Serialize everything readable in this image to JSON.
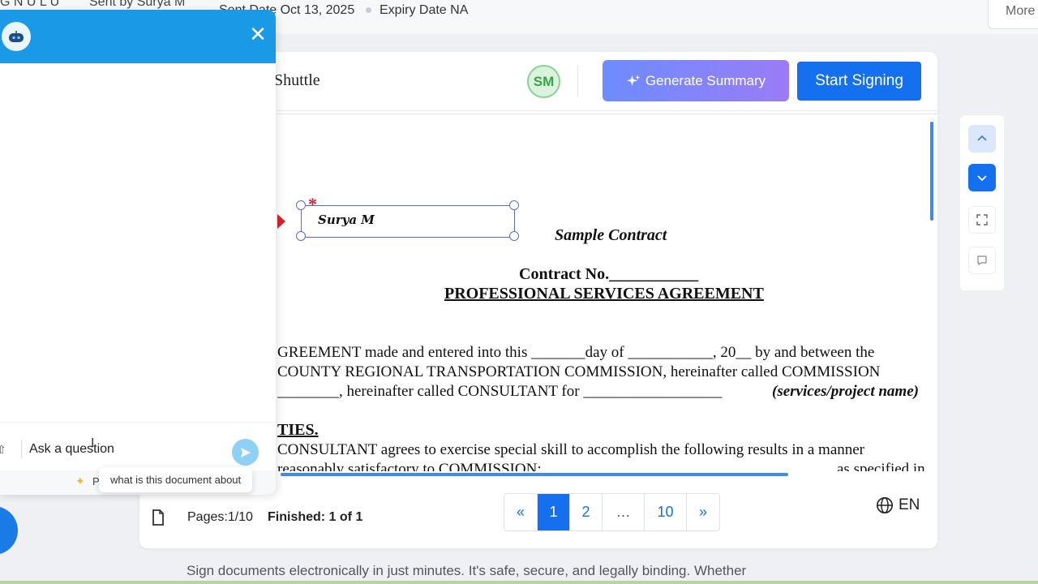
{
  "topbar": {
    "cut_left": "G N U L U",
    "sent_by": "Sent by Surya M",
    "sent_date": "Sent Date Oct 13, 2025",
    "expiry": "Expiry Date NA",
    "more_label": "More"
  },
  "header": {
    "doc_title": "Shuttle",
    "avatar_initials": "SM",
    "generate_summary_label": "Generate Summary",
    "start_signing_label": "Start Signing"
  },
  "document": {
    "signature_name": "Surya M",
    "sample_title": "Sample Contract",
    "contract_no": "Contract No.___________",
    "agreement_title": "PROFESSIONAL SERVICES AGREEMENT",
    "para1_line1": "GREEMENT made and entered into this _______day of ___________, 20__ by and between the",
    "para1_line2": "COUNTY REGIONAL TRANSPORTATION COMMISSION, hereinafter called COMMISSION",
    "para1_line3a": "________, hereinafter called CONSULTANT for __________________",
    "para1_line3b": "(services/project name)",
    "section_heading": "TIES.",
    "para2_line1": "CONSULTANT agrees to exercise special skill to accomplish the following results in a manner",
    "para2_line2a": "reasonably satisfactory to COMMISSION:",
    "para2_line2b": "as specified in"
  },
  "footer": {
    "pages": "Pages:1/10",
    "finished": "Finished: 1 of 1",
    "pagination": [
      "«",
      "1",
      "2",
      "…",
      "10",
      "»"
    ],
    "active_page": "1",
    "language": "EN"
  },
  "chat": {
    "input_placeholder": "Ask a question",
    "footer_text": "P",
    "suggestion": "what is this document about"
  },
  "bottom_text": "Sign documents electronically in just minutes. It's safe, secure, and legally binding. Whether",
  "colors": {
    "primary": "#1570ef",
    "chat_header": "#1a9ae6",
    "summary_gradient_start": "#6d8cff",
    "summary_gradient_end": "#9a7cf6",
    "required": "#d8202c"
  }
}
